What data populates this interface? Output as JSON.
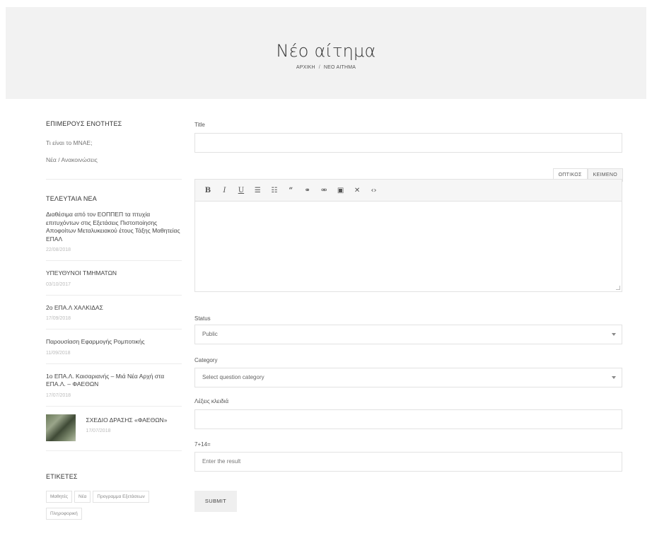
{
  "hero": {
    "title": "Νέο αίτημα",
    "breadcrumb": [
      "ΑΡΧΙΚΗ",
      "ΝΕΟ ΑΙΤΗΜΑ"
    ],
    "breadcrumb_sep": "/"
  },
  "sidebar": {
    "sections_heading": "ΕΠΙΜΕΡΟΥΣ ΕΝΟΤΗΤΕΣ",
    "section_links": [
      "Τι είναι το ΜΝΑΕ;",
      "Νέα / Ανακοινώσεις"
    ],
    "news_heading": "ΤΕΛΕΥΤΑΙΑ ΝΕΑ",
    "news": [
      {
        "title": "Διαθέσιμα από τον ΕΟΠΠΕΠ τα πτυχία επιτυχόντων στις Εξετάσεις Πιστοποίησης Αποφοίτων Μεταλυκειακού έτους Τάξης Μαθητείας ΕΠΑΛ",
        "date": "22/08/2018"
      },
      {
        "title": "ΥΠΕΥΘΥΝΟΙ ΤΜΗΜΑΤΩΝ",
        "date": "03/10/2017"
      },
      {
        "title": "2ο ΕΠΑ.Λ ΧΑΛΚΙΔΑΣ",
        "date": "17/09/2018"
      },
      {
        "title": "Παρουσίαση Εφαρμογής Ρομποτικής",
        "date": "11/09/2018"
      },
      {
        "title": "1ο ΕΠΑ.Λ. Καισαριανής – Μιά Νέα Αρχή στα ΕΠΑ.Λ. – ΦΑΕΘΩΝ",
        "date": "17/07/2018"
      },
      {
        "title": "ΣΧΕΔΙΟ ΔΡΑΣΗΣ «ΦΑΕΘΩΝ»",
        "date": "17/07/2018"
      }
    ],
    "tags_heading": "ΕΤΙΚΕΤΕΣ",
    "tags": [
      "Μαθητές",
      "Νέα",
      "Προγραμμα Εξετάσεων",
      "Πληροφορική"
    ]
  },
  "form": {
    "title_label": "Title",
    "title_value": "",
    "editor_tabs": [
      "ΟΠΤΙΚΟΣ",
      "ΚΕΙΜΕΝΟ"
    ],
    "toolbar_icons": [
      "bold-icon",
      "italic-icon",
      "underline-icon",
      "bullet-list-icon",
      "numbered-list-icon",
      "blockquote-icon",
      "link-icon",
      "unlink-icon",
      "image-icon",
      "fullscreen-icon",
      "code-icon"
    ],
    "status_label": "Status",
    "status_value": "Public",
    "category_label": "Category",
    "category_value": "Select question category",
    "keywords_label": "Λέξεις κλειδιά",
    "keywords_value": "",
    "captcha_label": "7+14=",
    "captcha_placeholder": "Enter the result",
    "submit_label": "SUBMIT"
  }
}
